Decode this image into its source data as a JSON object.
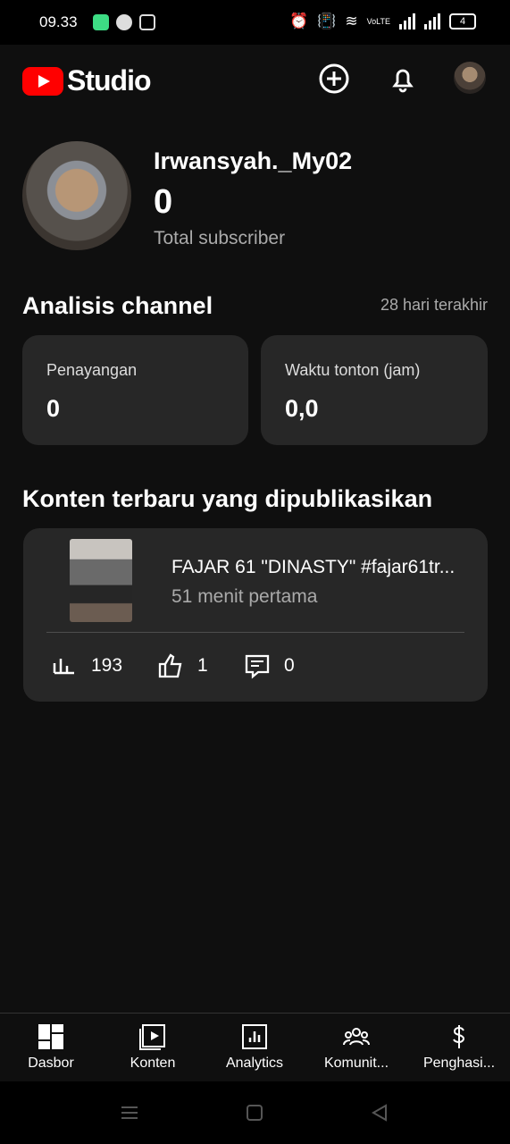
{
  "status_bar": {
    "time": "09.33",
    "network": "VoLTE",
    "battery": "4"
  },
  "app": {
    "logo_text": "Studio"
  },
  "profile": {
    "channel_name": "Irwansyah._My02",
    "subscribers": "0",
    "subscribers_label": "Total subscriber"
  },
  "analytics": {
    "title": "Analisis channel",
    "range": "28 hari terakhir",
    "cards": [
      {
        "label": "Penayangan",
        "value": "0"
      },
      {
        "label": "Waktu tonton (jam)",
        "value": "0,0"
      }
    ]
  },
  "latest": {
    "title": "Konten terbaru yang dipublikasikan",
    "video_title": "FAJAR 61 \"DINASTY\" #fajar61tr...",
    "video_subtitle": "51 menit pertama",
    "views": "193",
    "likes": "1",
    "comments": "0"
  },
  "bottom_nav": [
    {
      "label": "Dasbor",
      "icon": "dashboard-icon"
    },
    {
      "label": "Konten",
      "icon": "content-icon"
    },
    {
      "label": "Analytics",
      "icon": "analytics-icon"
    },
    {
      "label": "Komunit...",
      "icon": "community-icon"
    },
    {
      "label": "Penghasi...",
      "icon": "earn-icon"
    }
  ],
  "colors": {
    "background": "#0f0f0f",
    "card": "#272727",
    "accent": "#ff0000",
    "muted_text": "#aaaaaa"
  }
}
